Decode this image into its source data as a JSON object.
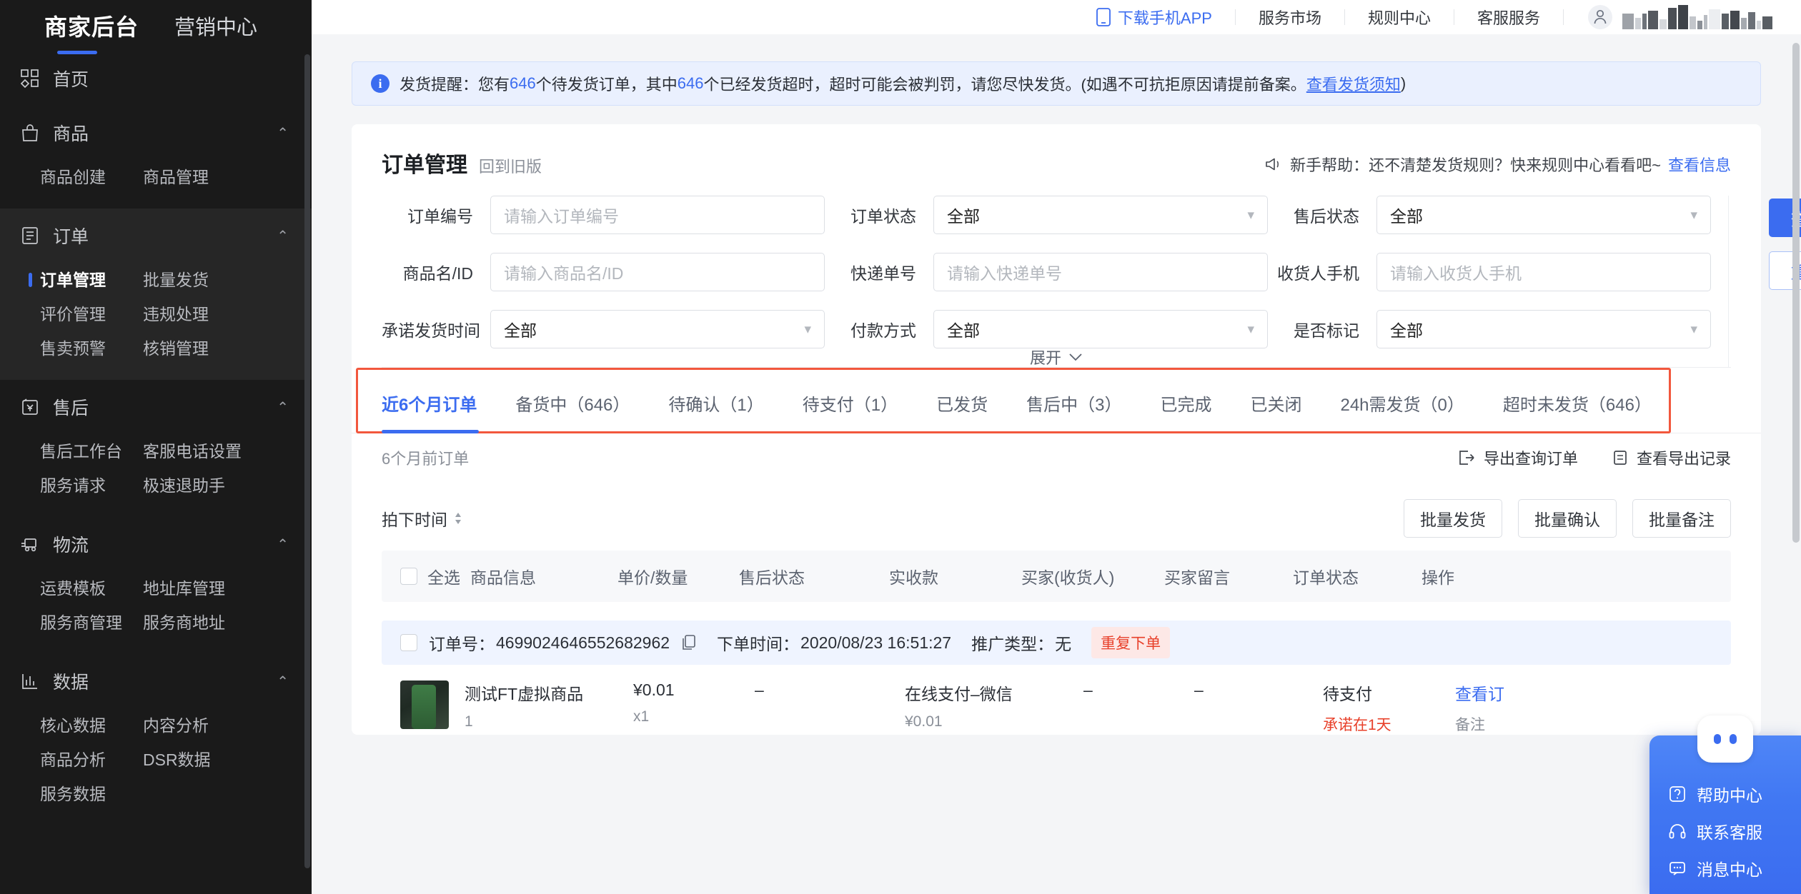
{
  "sidebar": {
    "brand_primary": "商家后台",
    "brand_secondary": "营销中心",
    "groups": [
      {
        "title": "首页",
        "icon": "grid-icon",
        "chevron": "",
        "links": []
      },
      {
        "title": "商品",
        "icon": "bag-icon",
        "chevron": "⌃",
        "links": [
          "商品创建",
          "商品管理"
        ]
      },
      {
        "title": "订单",
        "icon": "list-icon",
        "chevron": "⌃",
        "links": [
          "订单管理",
          "批量发货",
          "评价管理",
          "违规处理",
          "售卖预警",
          "核销管理"
        ],
        "current": "订单管理"
      },
      {
        "title": "售后",
        "icon": "refund-icon",
        "chevron": "⌃",
        "links": [
          "售后工作台",
          "客服电话设置",
          "服务请求",
          "极速退助手"
        ]
      },
      {
        "title": "物流",
        "icon": "truck-icon",
        "chevron": "⌃",
        "links": [
          "运费模板",
          "地址库管理",
          "服务商管理",
          "服务商地址"
        ]
      },
      {
        "title": "数据",
        "icon": "chart-icon",
        "chevron": "⌃",
        "links": [
          "核心数据",
          "内容分析",
          "商品分析",
          "DSR数据",
          "服务数据"
        ]
      }
    ]
  },
  "topbar": {
    "app_download": "下载手机APP",
    "items": [
      "服务市场",
      "规则中心",
      "客服服务"
    ],
    "username_redacted": true
  },
  "banner": {
    "prefix": "发货提醒：您有",
    "count1": "646",
    "mid1": "个待发货订单，其中",
    "count2": "646",
    "mid2": "个已经发货超时，超时可能会被判罚，请您尽快发货。(如遇不可抗拒原因请提前备案。",
    "link": "查看发货须知",
    "suffix": ")"
  },
  "card": {
    "title": "订单管理",
    "subtitle": "回到旧版",
    "helper_text": "新手帮助：还不清楚发货规则？快来规则中心看看吧~",
    "helper_link": "查看信息"
  },
  "filters": {
    "rows": [
      [
        {
          "label": "订单编号",
          "type": "input",
          "value": "",
          "placeholder": "请输入订单编号"
        },
        {
          "label": "订单状态",
          "type": "select",
          "value": "全部"
        },
        {
          "label": "售后状态",
          "type": "select",
          "value": "全部"
        }
      ],
      [
        {
          "label": "商品名/ID",
          "type": "input",
          "value": "",
          "placeholder": "请输入商品名/ID"
        },
        {
          "label": "快递单号",
          "type": "input",
          "value": "",
          "placeholder": "请输入快递单号"
        },
        {
          "label": "收货人手机",
          "type": "input",
          "value": "",
          "placeholder": "请输入收货人手机"
        }
      ],
      [
        {
          "label": "承诺发货时间",
          "type": "select",
          "value": "全部"
        },
        {
          "label": "付款方式",
          "type": "select",
          "value": "全部"
        },
        {
          "label": "是否标记",
          "type": "select",
          "value": "全部"
        }
      ]
    ],
    "search_button": "查 询",
    "reset_button": "重 置",
    "expand_label": "展开"
  },
  "tabs": [
    {
      "label": "近6个月订单",
      "active": true
    },
    {
      "label": "备货中（646）",
      "active": false
    },
    {
      "label": "待确认（1）",
      "active": false
    },
    {
      "label": "待支付（1）",
      "active": false
    },
    {
      "label": "已发货",
      "active": false
    },
    {
      "label": "售后中（3）",
      "active": false
    },
    {
      "label": "已完成",
      "active": false
    },
    {
      "label": "已关闭",
      "active": false
    },
    {
      "label": "24h需发货（0）",
      "active": false
    },
    {
      "label": "超时未发货（646）",
      "active": false
    }
  ],
  "subrow": {
    "left": "6个月前订单",
    "export_query": "导出查询订单",
    "export_records": "查看导出记录"
  },
  "toolbar": {
    "sort_label": "拍下时间",
    "buttons": [
      "批量发货",
      "批量确认",
      "批量备注"
    ]
  },
  "table": {
    "select_all": "全选",
    "headers": [
      "商品信息",
      "单价/数量",
      "售后状态",
      "实收款",
      "买家(收货人)",
      "买家留言",
      "订单状态",
      "操作"
    ],
    "orders": [
      {
        "order_no_label": "订单号：",
        "order_no": "4699024646552682962",
        "time_label": "下单时间：",
        "time": "2020/08/23 16:51:27",
        "promo_label": "推广类型：",
        "promo": "无",
        "badge": "重复下单",
        "product_name": "测试FT虚拟商品",
        "product_sub": "1",
        "unit_price": "¥0.01",
        "qty": "x1",
        "after_sale": "–",
        "payment": "在线支付–微信",
        "payment_amount": "¥0.01",
        "buyer": "–",
        "note": "–",
        "order_status": "待支付",
        "order_status_sub": "承诺在1天",
        "action_view": "查看订",
        "action_note": "备注"
      }
    ]
  },
  "help_widget": {
    "items": [
      {
        "label": "帮助中心",
        "icon": "question-icon"
      },
      {
        "label": "联系客服",
        "icon": "headset-icon"
      },
      {
        "label": "消息中心",
        "icon": "message-icon"
      }
    ]
  }
}
